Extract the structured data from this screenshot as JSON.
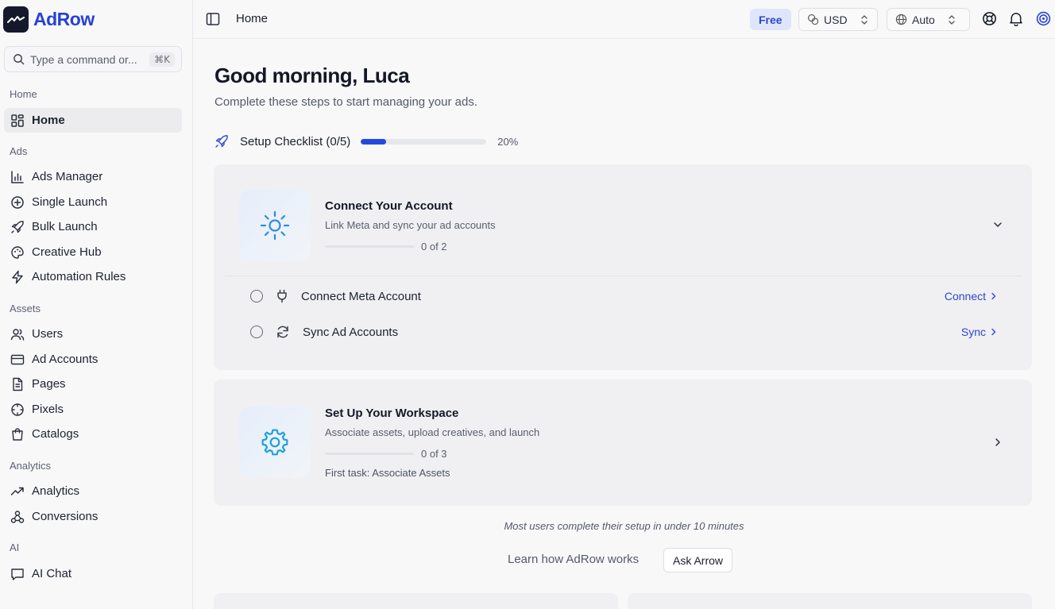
{
  "brand": {
    "name": "AdRow"
  },
  "command": {
    "placeholder": "Type a command or...",
    "shortcut": "⌘K"
  },
  "sidebar": {
    "sections": [
      {
        "label": "Home",
        "items": [
          {
            "label": "Home",
            "icon": "dashboard-icon",
            "active": true
          }
        ]
      },
      {
        "label": "Ads",
        "items": [
          {
            "label": "Ads Manager",
            "icon": "bar-chart-icon"
          },
          {
            "label": "Single Launch",
            "icon": "plus-circle-icon"
          },
          {
            "label": "Bulk Launch",
            "icon": "rocket-icon"
          },
          {
            "label": "Creative Hub",
            "icon": "palette-icon"
          },
          {
            "label": "Automation Rules",
            "icon": "lightning-icon"
          }
        ]
      },
      {
        "label": "Assets",
        "items": [
          {
            "label": "Users",
            "icon": "users-icon"
          },
          {
            "label": "Ad Accounts",
            "icon": "credit-card-icon"
          },
          {
            "label": "Pages",
            "icon": "document-icon"
          },
          {
            "label": "Pixels",
            "icon": "crosshair-icon"
          },
          {
            "label": "Catalogs",
            "icon": "shopping-bag-icon"
          }
        ]
      },
      {
        "label": "Analytics",
        "items": [
          {
            "label": "Analytics",
            "icon": "trending-up-icon"
          },
          {
            "label": "Conversions",
            "icon": "webhook-icon"
          }
        ]
      },
      {
        "label": "AI",
        "items": [
          {
            "label": "AI Chat",
            "icon": "chat-icon"
          }
        ]
      }
    ]
  },
  "topbar": {
    "title": "Home",
    "plan_badge": "Free",
    "currency": "USD",
    "timezone": "Auto"
  },
  "main": {
    "greeting": "Good morning, Luca",
    "subtitle": "Complete these steps to start managing your ads.",
    "checklist": {
      "label": "Setup Checklist (0/5)",
      "progress": 0.2,
      "percent_label": "20%"
    },
    "cards": [
      {
        "title": "Connect Your Account",
        "description": "Link Meta and sync your ad accounts",
        "count": "0 of 2",
        "tasks": [
          {
            "label": "Connect Meta Account",
            "action": "Connect",
            "icon": "plug-icon"
          },
          {
            "label": "Sync Ad Accounts",
            "action": "Sync",
            "icon": "refresh-icon"
          }
        ]
      },
      {
        "title": "Set Up Your Workspace",
        "description": "Associate assets, upload creatives, and launch",
        "count": "0 of 3",
        "first_task": "First task: Associate Assets"
      }
    ],
    "footnote": "Most users complete their setup in under 10 minutes",
    "learn_text": "Learn how AdRow works",
    "ask_button": "Ask Arrow"
  },
  "colors": {
    "accent": "#2348e0",
    "brand": "#2740d8",
    "icon_blue": "#2d8ae6"
  }
}
